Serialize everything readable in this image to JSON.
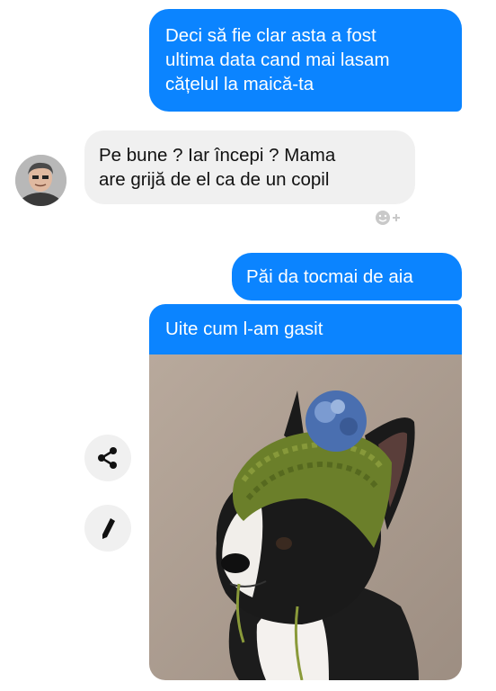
{
  "messages": [
    {
      "direction": "outgoing",
      "text": "Deci să fie clar asta a fost\nultima data cand mai lasam\ncățelul la maică-ta"
    },
    {
      "direction": "incoming",
      "text": "Pe bune ? Iar începi ? Mama\nare grijă de el ca de un copil"
    },
    {
      "direction": "outgoing",
      "text": "Păi da tocmai de aia"
    },
    {
      "direction": "outgoing",
      "text": "Uite cum l-am gasit"
    }
  ],
  "icons": {
    "avatar": "contact-avatar-photo",
    "reaction": "add-reaction-icon",
    "share": "share-icon",
    "edit": "pencil-icon",
    "photo": "dog-in-knitted-hat-photo"
  },
  "colors": {
    "outgoing_bubble": "#0b84ff",
    "incoming_bubble": "#f0f0f0",
    "background": "#ffffff"
  }
}
